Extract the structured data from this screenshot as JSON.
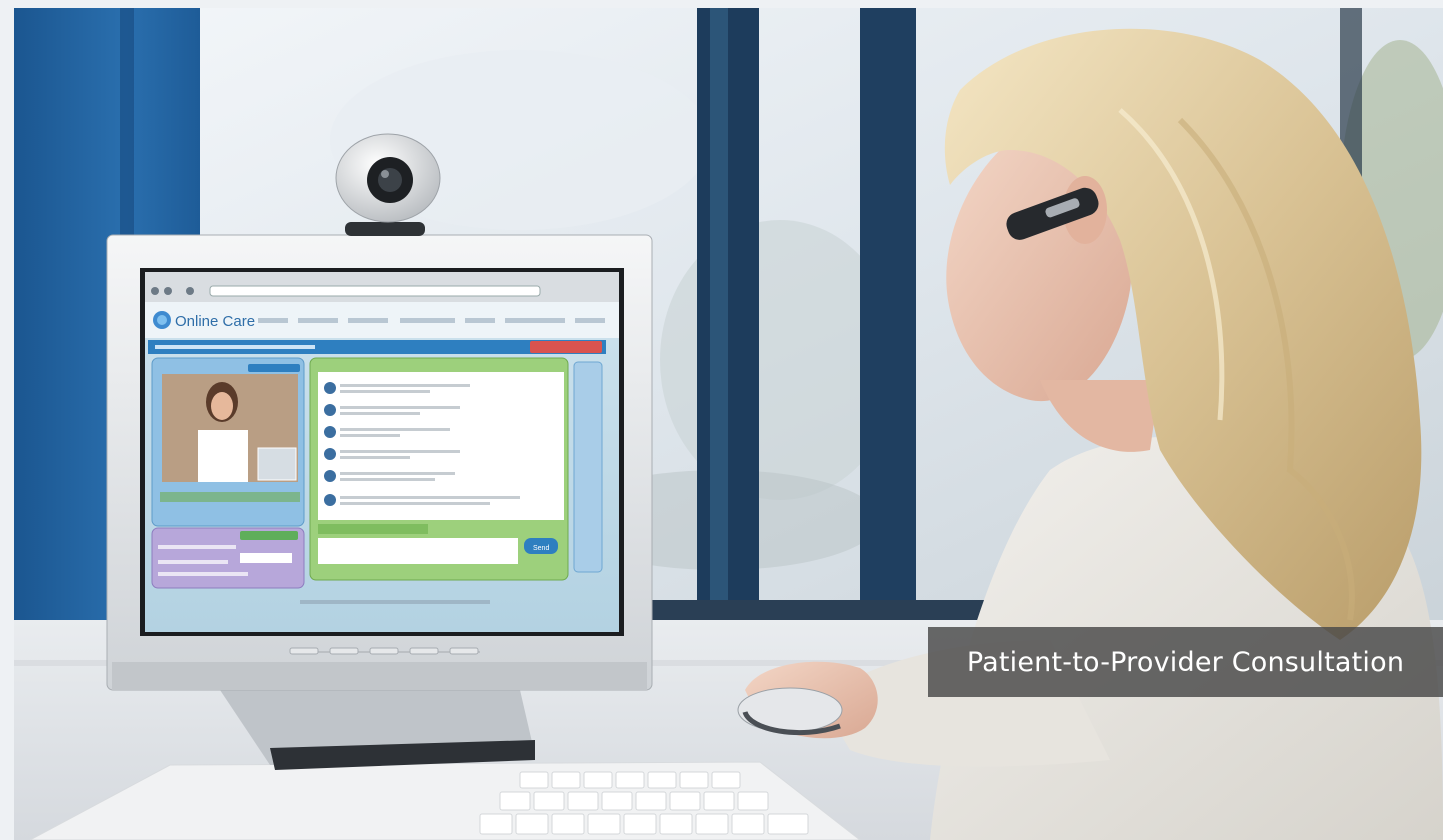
{
  "caption": {
    "text": "Patient-to-Provider Consultation"
  },
  "screen_app": {
    "logo_text": "Online Care",
    "logo_icon": "globe-icon",
    "send_label": "Send"
  },
  "colors": {
    "caption_bg": "#484848",
    "caption_text": "#ffffff",
    "app_blue": "#2e7fc0",
    "app_green": "#8cc46a",
    "app_purple": "#9b8cc4",
    "wall_blue": "#1f5f9c"
  }
}
